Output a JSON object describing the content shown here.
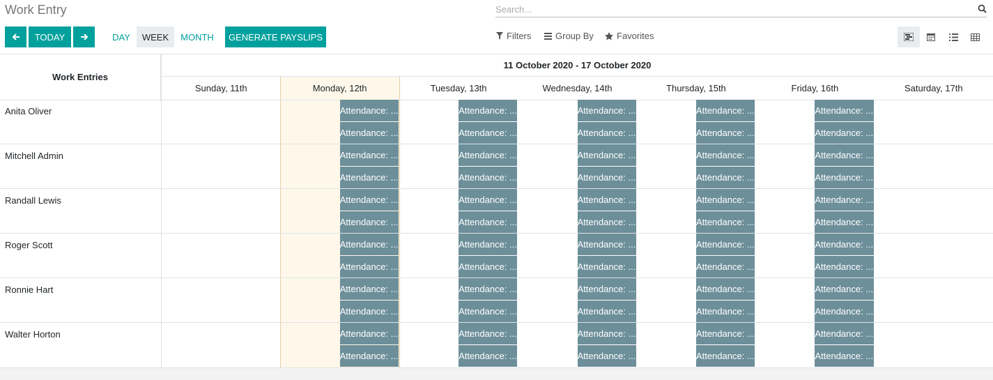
{
  "app": {
    "title": "Work Entry"
  },
  "search": {
    "placeholder": "Search..."
  },
  "nav": {
    "prev_icon": "arrow-left-icon",
    "today_label": "TODAY",
    "next_icon": "arrow-right-icon"
  },
  "scales": {
    "day": "DAY",
    "week": "WEEK",
    "month": "MONTH",
    "active": "week"
  },
  "actions": {
    "generate_label": "GENERATE PAYSLIPS"
  },
  "filters": {
    "filters_label": "Filters",
    "groupby_label": "Group By",
    "favorites_label": "Favorites"
  },
  "views": [
    "gantt-view-icon",
    "calendar-view-icon",
    "list-view-icon",
    "pivot-view-icon"
  ],
  "colors": {
    "primary": "#00a09d",
    "pill": "#6d8f9a",
    "today_bg": "#fff8ea"
  },
  "grid": {
    "row_header": "Work Entries",
    "period": "11 October 2020 - 17 October 2020",
    "days": [
      "Sunday, 11th",
      "Monday, 12th",
      "Tuesday, 13th",
      "Wednesday, 14th",
      "Thursday, 15th",
      "Friday, 16th",
      "Saturday, 17th"
    ],
    "today_index": 1,
    "employees": [
      "Anita Oliver",
      "Mitchell Admin",
      "Randall Lewis",
      "Roger Scott",
      "Ronnie Hart",
      "Walter Horton"
    ],
    "entry_label": "Attendance: ...",
    "entries_per_day": 2,
    "entry_days": [
      1,
      2,
      3,
      4,
      5
    ]
  }
}
